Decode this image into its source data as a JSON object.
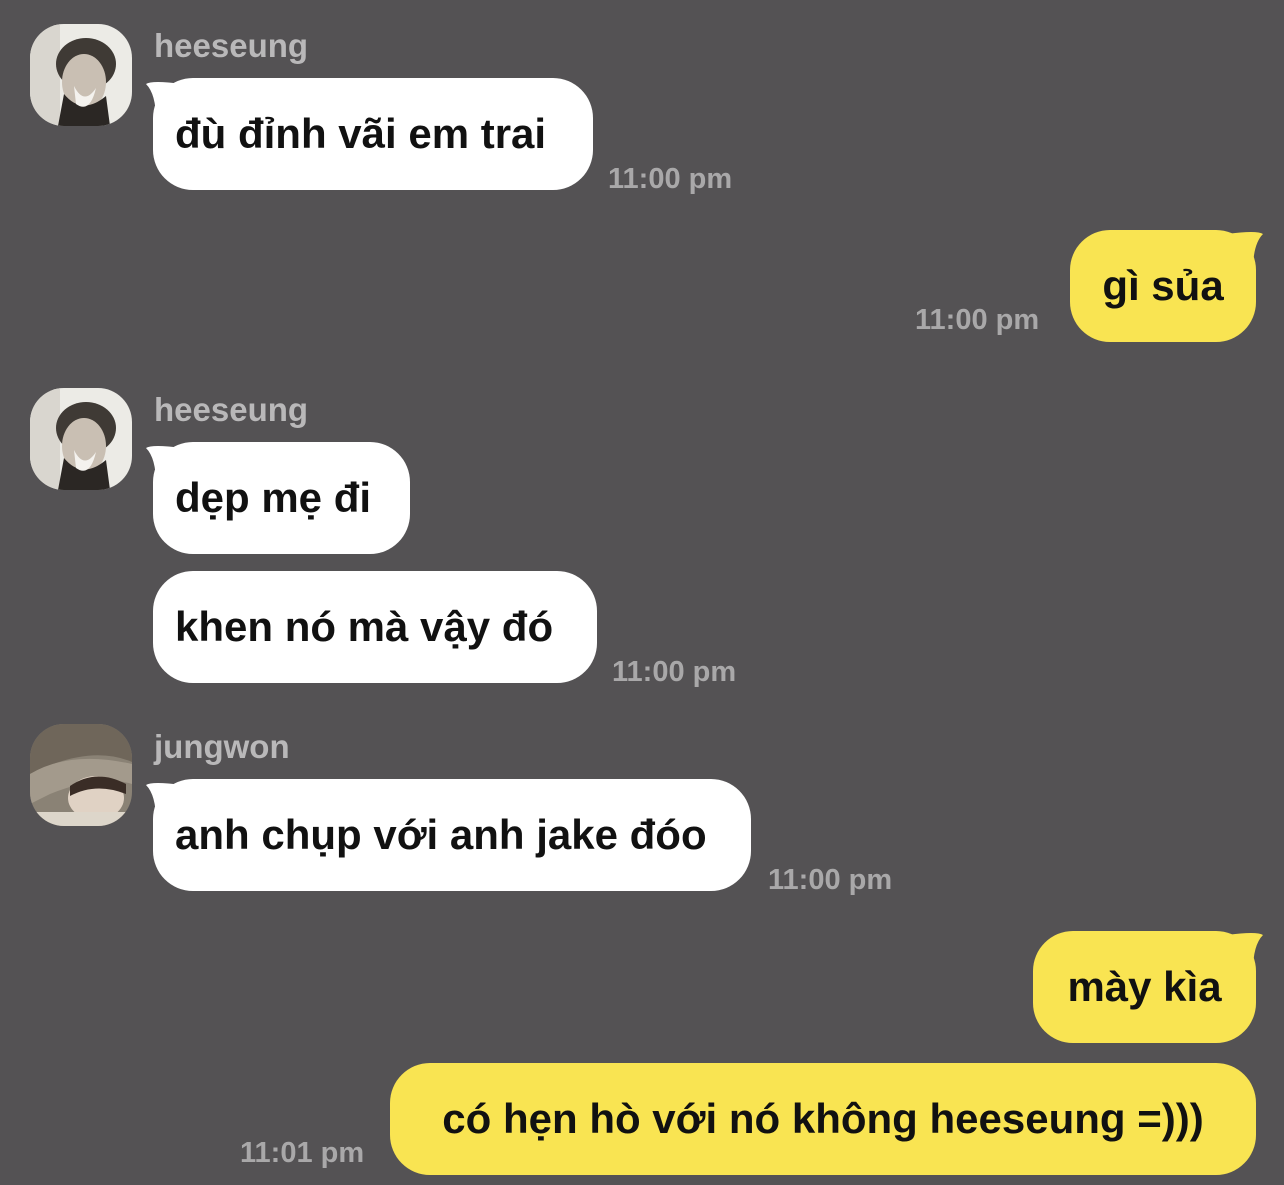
{
  "colors": {
    "background": "#545254",
    "incoming_bubble": "#ffffff",
    "outgoing_bubble": "#f9e452",
    "sender_name": "#b9b8b9",
    "timestamp": "#a9a8a9"
  },
  "messages": [
    {
      "sender": "heeseung",
      "avatar": "heeseung-avatar",
      "bubbles": [
        "đù đỉnh vãi em trai"
      ],
      "time": "11:00 pm"
    },
    {
      "sender": "me",
      "bubbles": [
        "gì sủa"
      ],
      "time": "11:00 pm"
    },
    {
      "sender": "heeseung",
      "avatar": "heeseung-avatar",
      "bubbles": [
        "dẹp mẹ đi",
        "khen nó mà vậy đó"
      ],
      "time": "11:00 pm"
    },
    {
      "sender": "jungwon",
      "avatar": "jungwon-avatar",
      "bubbles": [
        "anh chụp với anh jake đóo"
      ],
      "time": "11:00 pm"
    },
    {
      "sender": "me",
      "bubbles": [
        "mày kìa",
        "có hẹn hò với nó không heeseung =)))"
      ],
      "time": "11:01 pm"
    }
  ]
}
